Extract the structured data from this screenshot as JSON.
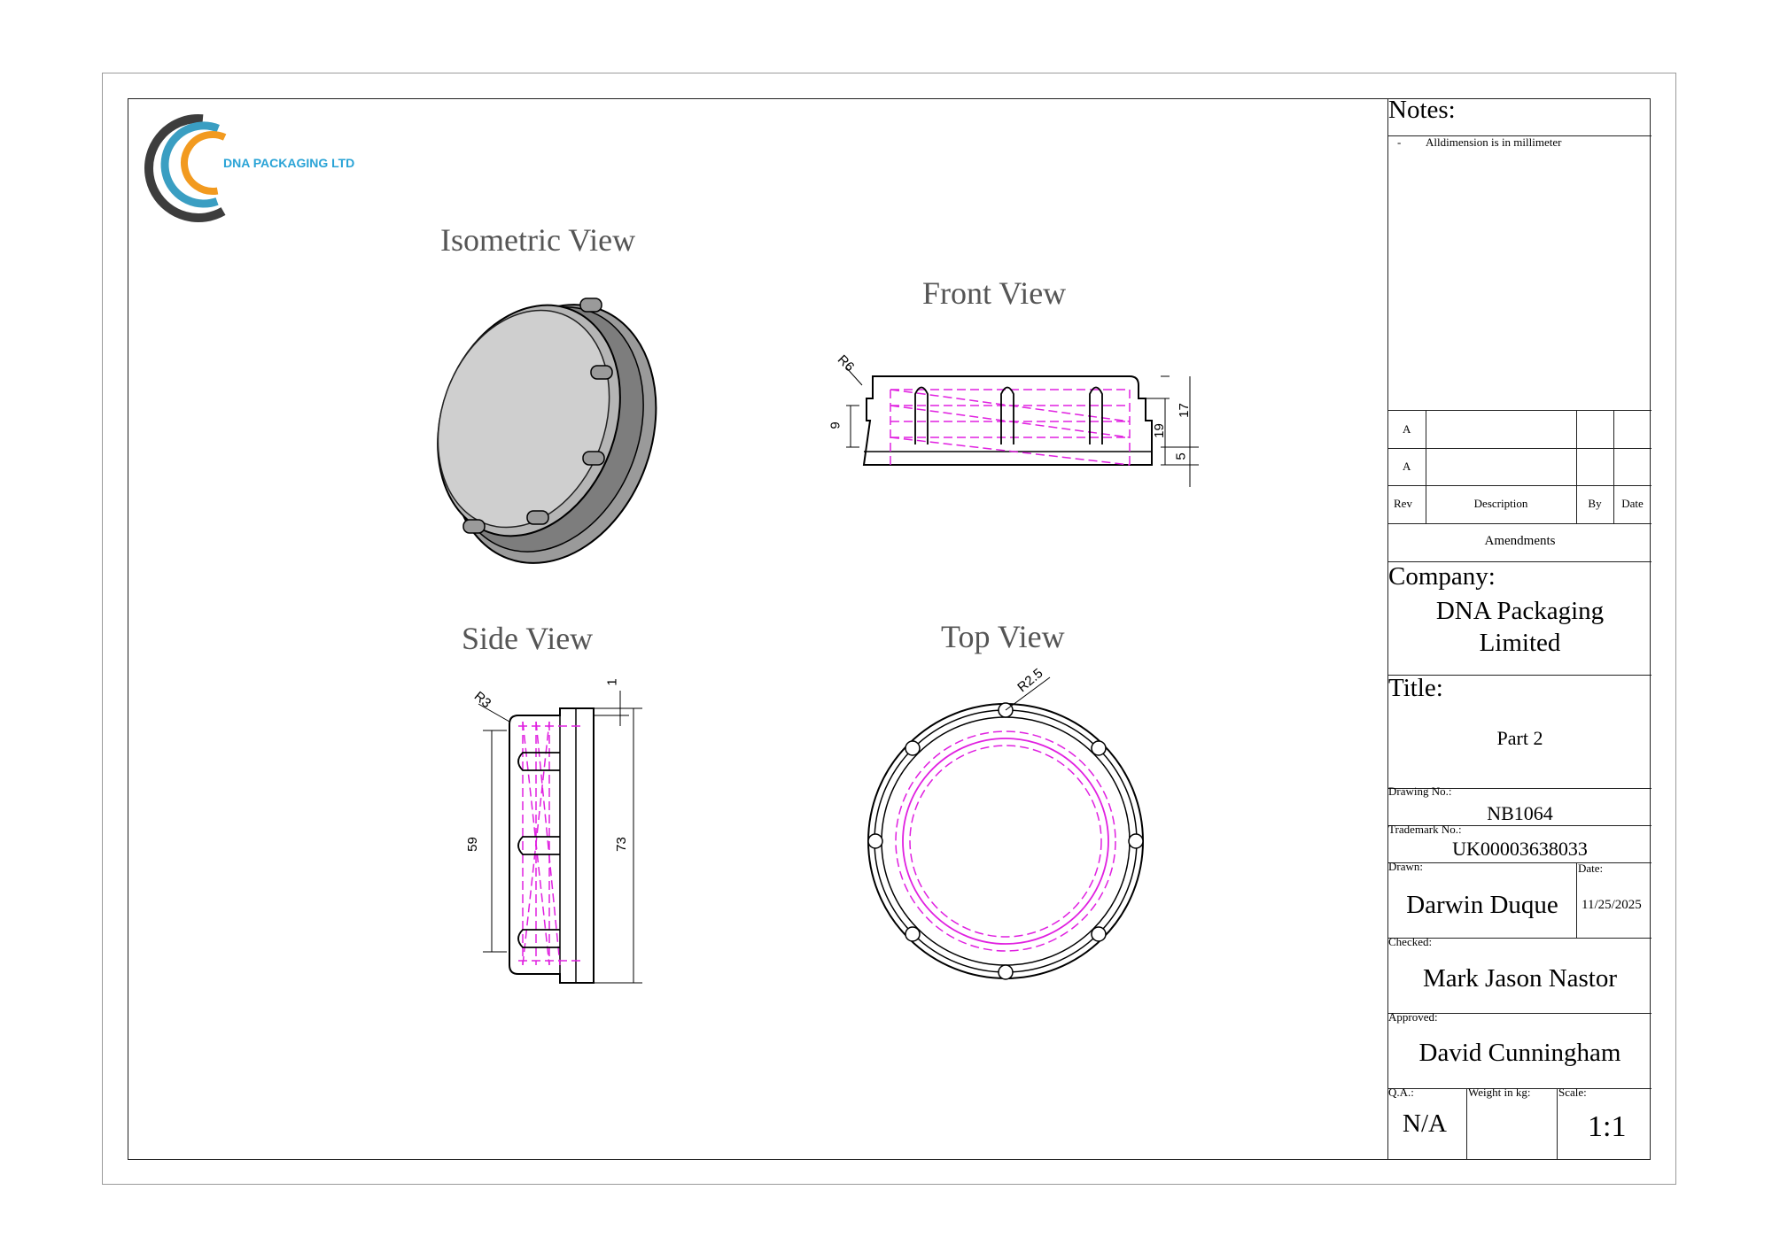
{
  "logo": {
    "text": "DNA PACKAGING LTD",
    "colors": {
      "blue": "#3a9ec2",
      "orange": "#f29a1f",
      "gray": "#3d3d3d",
      "text": "#29a3d6"
    }
  },
  "views": {
    "isometric": "Isometric View",
    "front": "Front View",
    "side": "Side View",
    "top": "Top View"
  },
  "dimensions": {
    "front": {
      "r6": "R6",
      "d9": "9",
      "d19": "19",
      "d17": "17",
      "d5": "5"
    },
    "side": {
      "r3": "R3",
      "d1": "1",
      "d59": "59",
      "d73": "73"
    },
    "top": {
      "r25": "R2.5"
    }
  },
  "colors": {
    "hidden_lines": "#e020e0",
    "outline": "#000000",
    "body_fill": "#cfcfcf",
    "view_title": "#555555"
  },
  "title_block": {
    "notes_label": "Notes:",
    "notes": [
      {
        "bullet": "-",
        "text": "Alldimension is in millimeter"
      }
    ],
    "revisions": [
      {
        "rev": "A",
        "description": "",
        "by": "",
        "date": ""
      },
      {
        "rev": "A",
        "description": "",
        "by": "",
        "date": ""
      }
    ],
    "rev_header": {
      "rev": "Rev",
      "description": "Description",
      "by": "By",
      "date": "Date"
    },
    "amendments_label": "Amendments",
    "company_label": "Company:",
    "company_line1": "DNA Packaging",
    "company_line2": "Limited",
    "title_label": "Title:",
    "title_value": "Part 2",
    "drawing_no_label": "Drawing No.:",
    "drawing_no": "NB1064",
    "trademark_label": "Trademark No.:",
    "trademark_no": "UK00003638033",
    "drawn_label": "Drawn:",
    "drawn_by": "Darwin Duque",
    "date_label": "Date:",
    "date_value": "11/25/2025",
    "checked_label": "Checked:",
    "checked_by": "Mark Jason Nastor",
    "approved_label": "Approved:",
    "approved_by": "David Cunningham",
    "qa_label": "Q.A.:",
    "qa_value": "N/A",
    "weight_label": "Weight in kg:",
    "weight_value": "",
    "scale_label": "Scale:",
    "scale_value": "1:1"
  }
}
